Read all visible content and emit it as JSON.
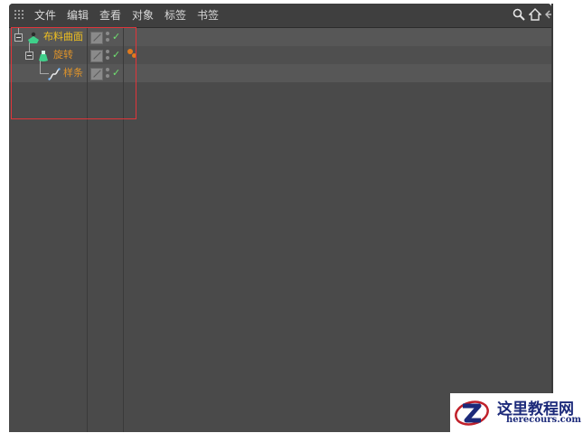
{
  "menu": {
    "items": [
      "文件",
      "编辑",
      "查看",
      "对象",
      "标签",
      "书签"
    ]
  },
  "toolbar": {
    "icons": [
      "search-icon",
      "home-icon",
      "back-icon"
    ]
  },
  "objects": [
    {
      "name": "布料曲面",
      "icon": "cloth-surface-icon",
      "color": "#f0c020",
      "expanded": true,
      "visible_check": true
    },
    {
      "name": "旋转",
      "icon": "lathe-icon",
      "color": "#e0942a",
      "expanded": true,
      "visible_check": true
    },
    {
      "name": "样条",
      "icon": "spline-icon",
      "color": "#e0942a",
      "expanded": false,
      "visible_check": true
    }
  ],
  "watermark": {
    "title": "这里教程网",
    "url": "herecours.com"
  },
  "colors": {
    "panel": "#4a4a4a",
    "menubar": "#3f3f3f",
    "highlight_box": "#e0353a",
    "check": "#6fe06f",
    "tag": "#e07a1e"
  }
}
